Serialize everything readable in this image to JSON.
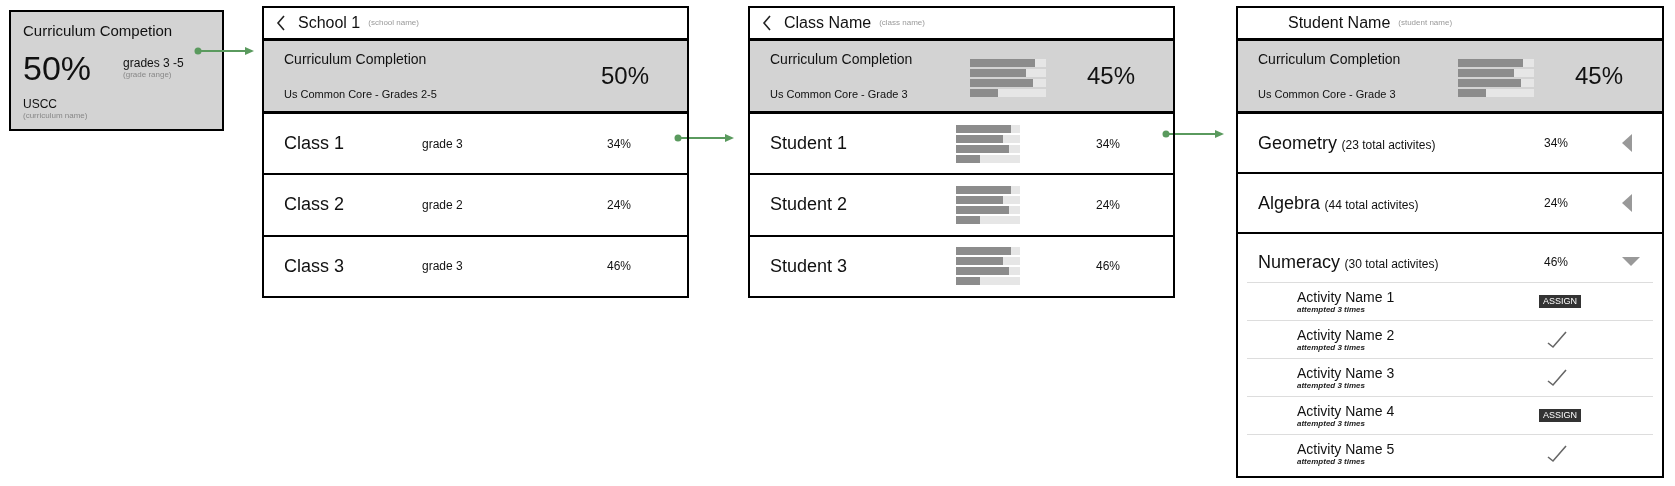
{
  "summary_card": {
    "title": "Curriculum Competion",
    "value": "50%",
    "grades": "grades 3 -5",
    "grades_hint": "(grade range)",
    "curriculum": "USCC",
    "curriculum_hint": "(curriculum name)"
  },
  "school_panel": {
    "title": "School 1",
    "hint": "(school name)",
    "summary": {
      "title": "Curriculum Completion",
      "curriculum": "Us Common Core - Grades 2-5",
      "value": "50%"
    },
    "rows": [
      {
        "name": "Class 1",
        "grade": "grade 3",
        "percent": "34%"
      },
      {
        "name": "Class 2",
        "grade": "grade 2",
        "percent": "24%"
      },
      {
        "name": "Class 3",
        "grade": "grade 3",
        "percent": "46%"
      }
    ]
  },
  "class_panel": {
    "title": "Class Name",
    "hint": "(class name)",
    "summary": {
      "title": "Curriculum Completion",
      "curriculum": "Us Common Core - Grade 3",
      "value": "45%",
      "bars": [
        {
          "level": 0.86
        },
        {
          "level": 0.74
        },
        {
          "level": 0.83
        },
        {
          "level": 0.37
        }
      ]
    },
    "rows": [
      {
        "name": "Student 1",
        "percent": "34%",
        "bars": [
          {
            "level": 0.86
          },
          {
            "level": 0.74
          },
          {
            "level": 0.83
          },
          {
            "level": 0.37
          }
        ]
      },
      {
        "name": "Student 2",
        "percent": "24%",
        "bars": [
          {
            "level": 0.86
          },
          {
            "level": 0.74
          },
          {
            "level": 0.83
          },
          {
            "level": 0.37
          }
        ]
      },
      {
        "name": "Student 3",
        "percent": "46%",
        "bars": [
          {
            "level": 0.86
          },
          {
            "level": 0.74
          },
          {
            "level": 0.83
          },
          {
            "level": 0.37
          }
        ]
      }
    ]
  },
  "student_panel": {
    "title": "Student Name",
    "hint": "(student name)",
    "summary": {
      "title": "Curriculum Completion",
      "curriculum": "Us Common Core - Grade 3",
      "value": "45%",
      "bars": [
        {
          "level": 0.86
        },
        {
          "level": 0.74
        },
        {
          "level": 0.83
        },
        {
          "level": 0.37
        }
      ]
    },
    "subjects": [
      {
        "name": "Geometry",
        "count": "(23 total activites)",
        "percent": "34%",
        "expanded": false
      },
      {
        "name": "Algebra",
        "count": "(44 total activites)",
        "percent": "24%",
        "expanded": false
      },
      {
        "name": "Numeracy",
        "count": "(30 total activites)",
        "percent": "46%",
        "expanded": true,
        "activities": [
          {
            "name": "Activity Name 1",
            "attempts": "attempted 3 times",
            "kind": "assign",
            "action": "ASSIGN"
          },
          {
            "name": "Activity Name 2",
            "attempts": "attempted 3 times",
            "kind": "done"
          },
          {
            "name": "Activity Name 3",
            "attempts": "attempted 3 times",
            "kind": "done"
          },
          {
            "name": "Activity Name 4",
            "attempts": "attempted 3 times",
            "kind": "assign",
            "action": "ASSIGN"
          },
          {
            "name": "Activity Name 5",
            "attempts": "attempted 3 times",
            "kind": "done"
          }
        ]
      }
    ]
  }
}
